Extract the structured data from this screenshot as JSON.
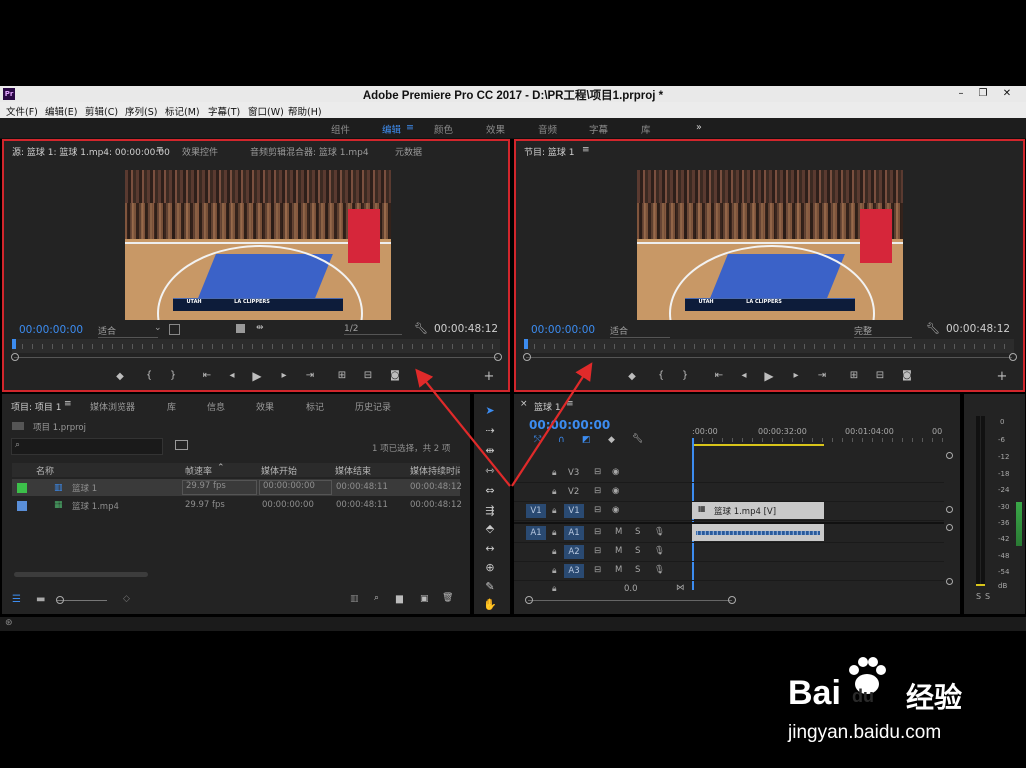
{
  "window": {
    "title": "Adobe Premiere Pro CC 2017 - D:\\PR工程\\项目1.prproj *",
    "app_icon": "Pr",
    "controls": [
      "–",
      "❐",
      "✕"
    ]
  },
  "menu": [
    "文件(F)",
    "编辑(E)",
    "剪辑(C)",
    "序列(S)",
    "标记(M)",
    "字幕(T)",
    "窗口(W)",
    "帮助(H)"
  ],
  "workspaces": {
    "items": [
      "组件",
      "编辑",
      "颜色",
      "效果",
      "音频",
      "字幕",
      "库"
    ],
    "active": "编辑",
    "more": "»"
  },
  "source": {
    "tabs": [
      "源: 篮球 1: 篮球 1.mp4: 00:00:00:00",
      "效果控件",
      "音频剪辑混合器: 篮球 1.mp4",
      "元数据"
    ],
    "timecode_in": "00:00:00:00",
    "fit": "适合",
    "resolution": "1/2",
    "duration": "00:00:48:12"
  },
  "program": {
    "tab": "节目: 篮球 1",
    "timecode_in": "00:00:00:00",
    "fit": "适合",
    "quality": "完整",
    "duration": "00:00:48:12"
  },
  "scoreboard": {
    "home": "UTAH",
    "away": "LA CLIPPERS"
  },
  "project": {
    "tabs": [
      "项目: 项目 1",
      "媒体浏览器",
      "库",
      "信息",
      "效果",
      "标记",
      "历史记录"
    ],
    "file": "项目 1.prproj",
    "selection": "1 项已选择，共 2 项",
    "columns": [
      "名称",
      "帧速率",
      "媒体开始",
      "媒体结束",
      "媒体持续时间"
    ],
    "rows": [
      {
        "name": "篮球 1",
        "fps": "29.97 fps",
        "start": "00:00:00:00",
        "end": "00:00:48:11",
        "dur": "00:00:48:12",
        "color": "#3cbf4a"
      },
      {
        "name": "篮球 1.mp4",
        "fps": "29.97 fps",
        "start": "00:00:00:00",
        "end": "00:00:48:11",
        "dur": "00:00:48:12",
        "color": "#5a8fd8"
      }
    ]
  },
  "timeline": {
    "tab": "篮球 1",
    "timecode": "00:00:00:00",
    "ruler": [
      ":00:00",
      "00:00:32:00",
      "00:01:04:00",
      "00"
    ],
    "video_tracks": [
      "V3",
      "V2",
      "V1"
    ],
    "audio_tracks": [
      "A1",
      "A2",
      "A3"
    ],
    "source_patch_v": "V1",
    "source_patch_a": "A1",
    "master_value": "0.0",
    "clip_video": "篮球 1.mp4 [V]",
    "track_m": "M",
    "track_s": "S"
  },
  "meter": {
    "scale": [
      "0",
      "-6",
      "-12",
      "-18",
      "-24",
      "-30",
      "-36",
      "-42",
      "-48",
      "-54",
      "dB"
    ],
    "solo": [
      "S",
      "S"
    ]
  },
  "watermark": {
    "brand": "Bai",
    "brand_du": "du",
    "brand_cn": "经验",
    "url": "jingyan.baidu.com"
  }
}
